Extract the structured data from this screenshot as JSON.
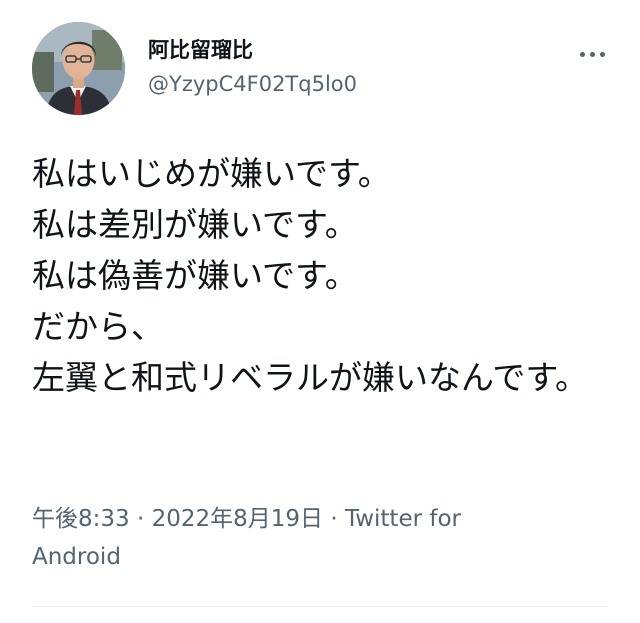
{
  "user": {
    "display_name": "阿比留瑠比",
    "handle": "@YzypC4F02Tq5lo0",
    "avatar_icon": "user-avatar-photo"
  },
  "menu": {
    "icon": "more-horizontal-icon"
  },
  "tweet": {
    "text": "私はいじめが嫌いです。\n私は差別が嫌いです。\n私は偽善が嫌いです。\nだから、\n左翼と和式リベラルが嫌いなんです。"
  },
  "meta": {
    "time": "午後8:33",
    "date": "2022年8月19日",
    "source": "Twitter for Android",
    "separator": " · "
  },
  "colors": {
    "text": "#0f1419",
    "secondary": "#536471",
    "divider": "#eff3f4",
    "background": "#ffffff"
  }
}
